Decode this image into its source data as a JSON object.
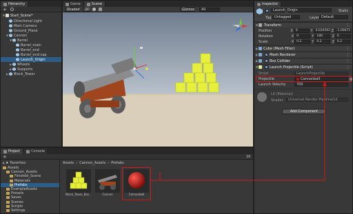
{
  "hierarchy": {
    "tab": "Hierarchy",
    "scene": "Start_Scene*",
    "items": [
      {
        "label": "Directional Light",
        "indent": 1
      },
      {
        "label": "Main Camera",
        "indent": 1
      },
      {
        "label": "Ground_Plane",
        "indent": 1
      },
      {
        "label": "Cannon",
        "indent": 1
      },
      {
        "label": "Barrel",
        "indent": 2
      },
      {
        "label": "Barrel_main",
        "indent": 3
      },
      {
        "label": "Barrel_end",
        "indent": 3
      },
      {
        "label": "Barrel_end-cap",
        "indent": 3
      },
      {
        "label": "Launch_Origin",
        "indent": 3
      },
      {
        "label": "Wheels",
        "indent": 2
      },
      {
        "label": "Supports",
        "indent": 2
      },
      {
        "label": "Block_Tower",
        "indent": 1
      }
    ],
    "selected": "Launch_Origin"
  },
  "scene_view": {
    "tab_game": "Game",
    "tab_scene": "Scene",
    "shading": "Shaded",
    "mode": "2D",
    "gizmos": "Gizmos",
    "search_placeholder": "All"
  },
  "inspector": {
    "tab": "Inspector",
    "object_name": "Launch_Origin",
    "static_label": "Static",
    "tag_label": "Tag",
    "tag_value": "Untagged",
    "layer_label": "Layer",
    "layer_value": "Default",
    "transform": {
      "title": "Transform",
      "position_label": "Position",
      "rotation_label": "Rotation",
      "scale_label": "Scale",
      "position": {
        "x": "0",
        "y": "0.026592",
        "z": "-1.00671"
      },
      "rotation": {
        "x": "0",
        "y": "180",
        "z": "0"
      },
      "scale": {
        "x": "0.2",
        "y": "0.2",
        "z": "0.2"
      }
    },
    "components": [
      "Cube (Mesh Filter)",
      "Mesh Renderer",
      "Box Collider",
      "Launch Projectile (Script)"
    ],
    "script_label": "Script",
    "script_value": "LaunchProjectile",
    "projectile_label": "Projectile",
    "projectile_value": "Cannonball",
    "launch_velocity_label": "Launch Velocity",
    "launch_velocity_value": "700",
    "material_name": "Lit (Material)",
    "shader_label": "Shader",
    "shader_value": "Universal Render Pipeline/Lit",
    "add_component": "Add Component"
  },
  "project": {
    "tab_project": "Project",
    "tab_console": "Console",
    "favorites": "Favorites",
    "tree": [
      {
        "label": "Assets",
        "indent": 0
      },
      {
        "label": "Cannon_Assets",
        "indent": 1
      },
      {
        "label": "Finished_Scene",
        "indent": 2
      },
      {
        "label": "Materials",
        "indent": 2
      },
      {
        "label": "Prefabs",
        "indent": 2
      },
      {
        "label": "ExampleAssets",
        "indent": 1
      },
      {
        "label": "Presets",
        "indent": 1
      },
      {
        "label": "Saves",
        "indent": 1
      },
      {
        "label": "Scenes",
        "indent": 1
      },
      {
        "label": "Scripts",
        "indent": 1
      },
      {
        "label": "Settings",
        "indent": 1
      }
    ],
    "breadcrumb": [
      "Assets",
      "Cannon_Assets",
      "Prefabs"
    ],
    "assets": [
      {
        "label": "Block_Tower_Bas...",
        "type": "tower"
      },
      {
        "label": "Cannon",
        "type": "cannon"
      },
      {
        "label": "Cannonball",
        "type": "ball"
      }
    ],
    "count": "16"
  },
  "colors": {
    "accent": "#2c5d87",
    "highlight": "#d01818",
    "cube_yellow": "#e6f03c",
    "cannonball": "#c0140c"
  }
}
